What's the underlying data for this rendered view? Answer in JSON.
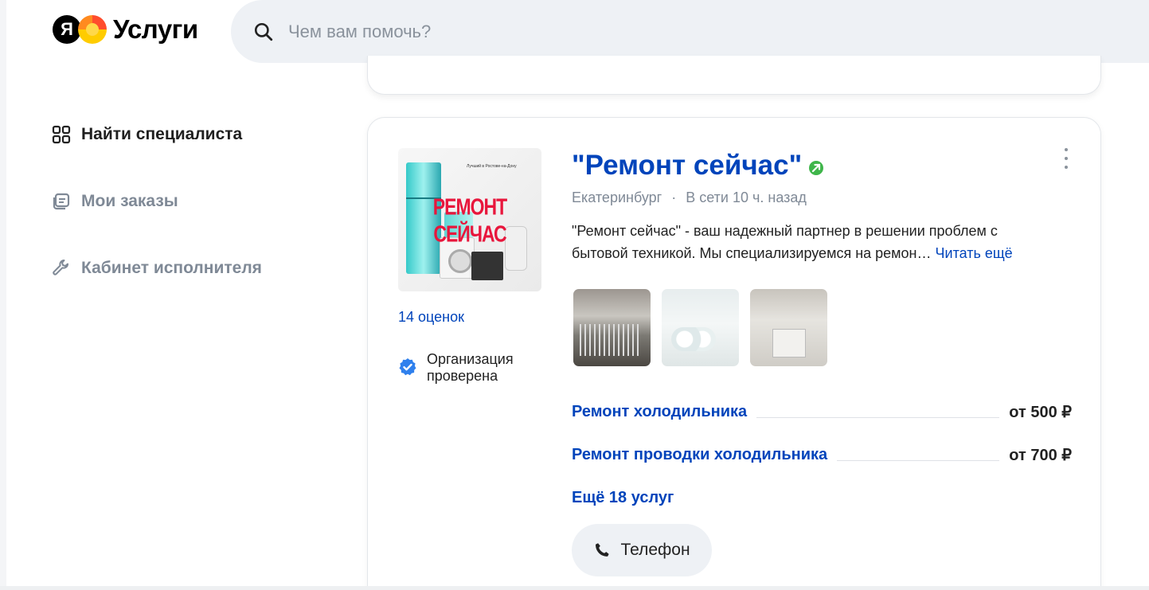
{
  "header": {
    "logo_letter": "Я",
    "logo_text": "Услуги",
    "search_placeholder": "Чем вам помочь?"
  },
  "sidebar": {
    "items": [
      {
        "label": "Найти специалиста",
        "icon": "grid-icon",
        "active": true
      },
      {
        "label": "Мои заказы",
        "icon": "orders-icon",
        "active": false
      },
      {
        "label": "Кабинет исполнителя",
        "icon": "wrench-icon",
        "active": false
      }
    ]
  },
  "card": {
    "thumb_brand": "РЕМОНТ СЕЙЧАС",
    "thumb_small": "Лучший в Ростове-на-Дону",
    "ratings": "14 оценок",
    "verified": "Организация проверена",
    "title": "\"Ремонт сейчас\"",
    "city": "Екатеринбург",
    "separator": "·",
    "online": "В сети 10 ч. назад",
    "description": "\"Ремонт сейчас\" - ваш надежный партнер в решении проблем с бытовой техникой. Мы специализируемся на ремон…",
    "read_more": "Читать ещё",
    "services": [
      {
        "name": "Ремонт холодильника",
        "price": "от 500 ₽"
      },
      {
        "name": "Ремонт проводки холодильника",
        "price": "от 700 ₽"
      }
    ],
    "more_services": "Ещё 18 услуг",
    "phone_button": "Телефон"
  },
  "colors": {
    "link": "#0044bb",
    "muted": "#7f8996",
    "search_bg": "#eef1f5",
    "verified": "#2f80ed",
    "online_badge": "#3fb54a"
  }
}
